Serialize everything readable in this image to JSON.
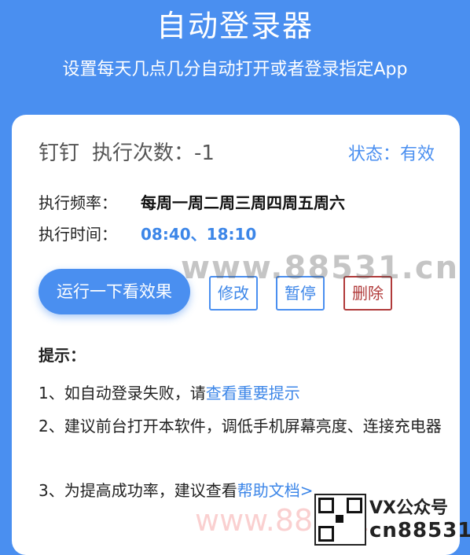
{
  "header": {
    "title": "自动登录器",
    "subtitle": "设置每天几点几分自动打开或者登录指定App"
  },
  "task": {
    "app_name": "钉钉",
    "exec_count_label": "执行次数：-1",
    "status_label": "状态：有效",
    "frequency_label": "执行频率：",
    "frequency_value": "每周一周二周三周四周五周六",
    "time_label": "执行时间：",
    "time_value": "08:40、18:10"
  },
  "actions": {
    "run_label": "运行一下看效果",
    "edit_label": "修改",
    "pause_label": "暂停",
    "delete_label": "删除"
  },
  "tips": {
    "title": "提示：",
    "tip1_prefix": "1、如自动登录失败，请",
    "tip1_link": "查看重要提示",
    "tip2": "2、建议前台打开本软件，调低手机屏幕亮度、连接充电器",
    "tip3_prefix": "3、为提高成功率，建议查看",
    "tip3_link": "帮助文档>"
  },
  "overlay": {
    "watermark": "www.88531.cn",
    "watermark_bottom": "www.88531",
    "vx_label": "VX公众号",
    "vx_id": "cn88531"
  },
  "colors": {
    "accent": "#4a8ff0",
    "danger": "#b03a3a"
  }
}
